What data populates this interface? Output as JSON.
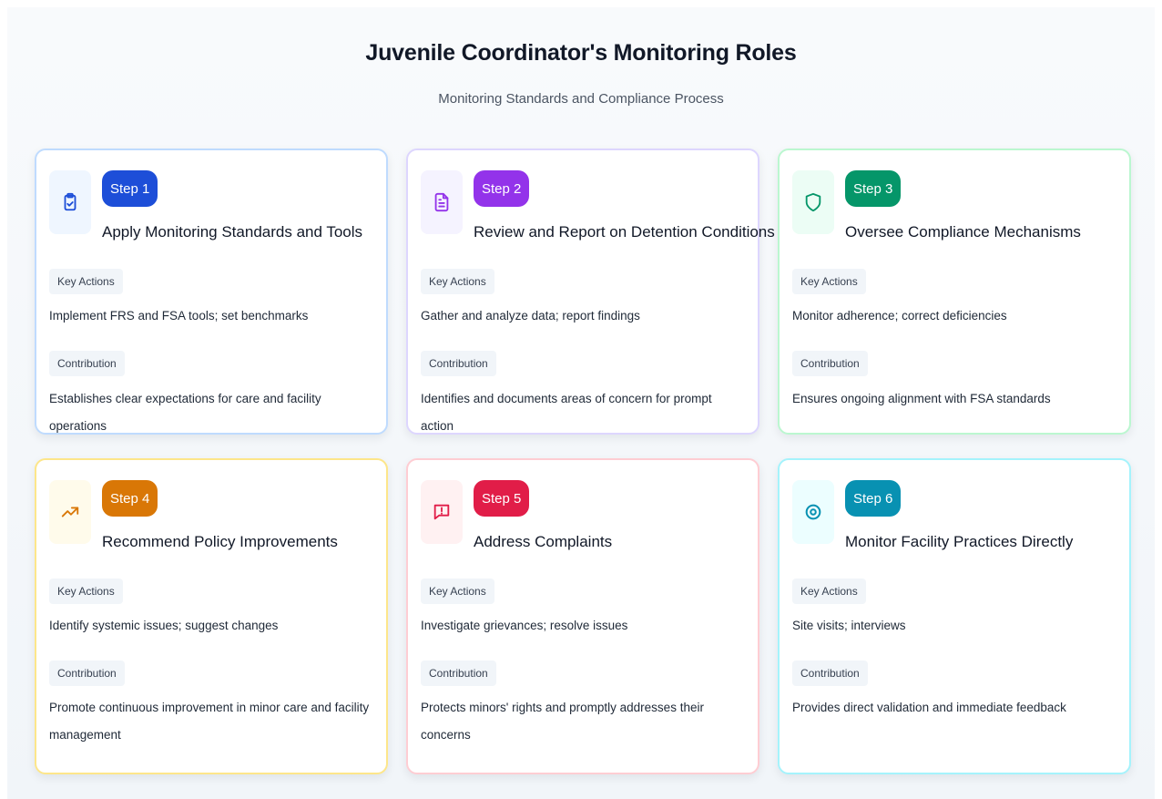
{
  "header": {
    "title": "Juvenile Coordinator's Monitoring Roles",
    "subtitle": "Monitoring Standards and Compliance Process"
  },
  "labels": {
    "key_actions": "Key Actions",
    "contribution": "Contribution"
  },
  "steps": [
    {
      "badge": "Step 1",
      "title": "Apply Monitoring Standards and Tools",
      "key_actions": "Implement FRS and FSA tools; set benchmarks",
      "contribution": "Establishes clear expectations for care and facility operations",
      "icon": "clipboard-check-icon",
      "accent": "#1d4ed8",
      "border": "#bfdbfe",
      "icon_bg": "#eff6ff"
    },
    {
      "badge": "Step 2",
      "title": "Review and Report on Detention Conditions",
      "key_actions": "Gather and analyze data; report findings",
      "contribution": "Identifies and documents areas of concern for prompt action",
      "icon": "document-icon",
      "accent": "#9333ea",
      "border": "#ddd6fe",
      "icon_bg": "#f5f3ff"
    },
    {
      "badge": "Step 3",
      "title": "Oversee Compliance Mechanisms",
      "key_actions": "Monitor adherence; correct deficiencies",
      "contribution": "Ensures ongoing alignment with FSA standards",
      "icon": "shield-icon",
      "accent": "#059669",
      "border": "#bbf7d0",
      "icon_bg": "#ecfdf5"
    },
    {
      "badge": "Step 4",
      "title": "Recommend Policy Improvements",
      "key_actions": "Identify systemic issues; suggest changes",
      "contribution": "Promote continuous improvement in minor care and facility management",
      "icon": "trending-up-icon",
      "accent": "#d97706",
      "border": "#fde68a",
      "icon_bg": "#fffbeb"
    },
    {
      "badge": "Step 5",
      "title": "Address Complaints",
      "key_actions": "Investigate grievances; resolve issues",
      "contribution": "Protects minors' rights and promptly addresses their concerns",
      "icon": "alert-message-icon",
      "accent": "#e11d48",
      "border": "#fecdd3",
      "icon_bg": "#fff1f2"
    },
    {
      "badge": "Step 6",
      "title": "Monitor Facility Practices Directly",
      "key_actions": "Site visits; interviews",
      "contribution": "Provides direct validation and immediate feedback",
      "icon": "eye-target-icon",
      "accent": "#0891b2",
      "border": "#a5f3fc",
      "icon_bg": "#ecfeff"
    }
  ]
}
